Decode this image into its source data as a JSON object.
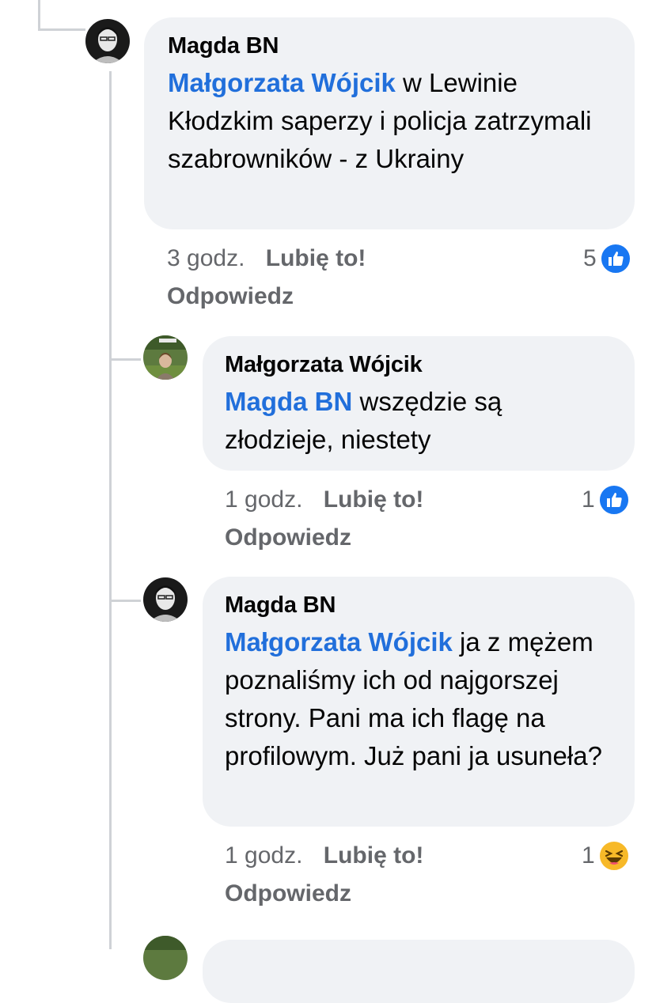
{
  "comments": [
    {
      "author": "Magda BN",
      "mention": "Małgorzata Wójcik",
      "text": " w Lewinie Kłodzkim saperzy i policja zatrzymali szabrowników - z Ukrainy",
      "time": "3 godz.",
      "like_label": "Lubię to!",
      "reply_label": "Odpowiedz",
      "reaction_count": "5",
      "reaction_icon": "like-icon"
    },
    {
      "author": "Małgorzata Wójcik",
      "mention": "Magda BN",
      "text": " wszędzie są złodzieje, niestety",
      "time": "1 godz.",
      "like_label": "Lubię to!",
      "reply_label": "Odpowiedz",
      "reaction_count": "1",
      "reaction_icon": "like-icon"
    },
    {
      "author": "Magda BN",
      "mention": "Małgorzata Wójcik",
      "text": " ja z mężem poznaliśmy ich od najgorszej strony. Pani ma ich flagę na profilowym. Już pani ja usuneła?",
      "time": "1 godz.",
      "like_label": "Lubię to!",
      "reply_label": "Odpowiedz",
      "reaction_count": "1",
      "reaction_icon": "haha-icon"
    }
  ],
  "colors": {
    "mention": "#216fdb",
    "bubble": "#f0f2f5",
    "meta": "#65676b",
    "like_blue": "#1877f2",
    "haha_yellow": "#f7b928"
  }
}
